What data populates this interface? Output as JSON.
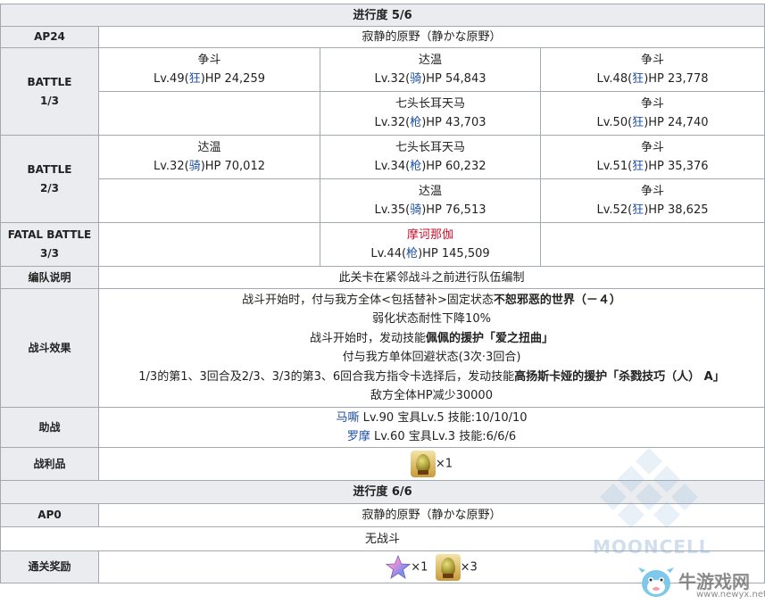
{
  "progress5": {
    "header": "进行度 5/6",
    "ap_label": "AP24",
    "location": "寂静的原野（静かな原野）",
    "battles": [
      {
        "label": [
          "BATTLE",
          "1/3"
        ],
        "rows": [
          [
            {
              "name": "争斗",
              "lv": "Lv.49(",
              "cls": "狂",
              "hp": ")HP 24,259"
            },
            {
              "name": "达温",
              "lv": "Lv.32(",
              "cls": "骑",
              "hp": ")HP 54,843"
            },
            {
              "name": "争斗",
              "lv": "Lv.48(",
              "cls": "狂",
              "hp": ")HP 23,778"
            }
          ],
          [
            null,
            {
              "name": "七头长耳天马",
              "lv": "Lv.32(",
              "cls": "枪",
              "hp": ")HP 43,703"
            },
            {
              "name": "争斗",
              "lv": "Lv.50(",
              "cls": "狂",
              "hp": ")HP 24,740"
            }
          ]
        ]
      },
      {
        "label": [
          "BATTLE",
          "2/3"
        ],
        "rows": [
          [
            {
              "name": "达温",
              "lv": "Lv.32(",
              "cls": "骑",
              "hp": ")HP 70,012"
            },
            {
              "name": "七头长耳天马",
              "lv": "Lv.34(",
              "cls": "枪",
              "hp": ")HP 60,232"
            },
            {
              "name": "争斗",
              "lv": "Lv.51(",
              "cls": "狂",
              "hp": ")HP 35,376"
            }
          ],
          [
            null,
            {
              "name": "达温",
              "lv": "Lv.35(",
              "cls": "骑",
              "hp": ")HP 76,513"
            },
            {
              "name": "争斗",
              "lv": "Lv.52(",
              "cls": "狂",
              "hp": ")HP 38,625"
            }
          ]
        ]
      },
      {
        "label": [
          "FATAL BATTLE",
          "3/3"
        ],
        "rows": [
          [
            null,
            {
              "name": "摩诃那伽",
              "lv": "Lv.44(",
              "cls": "枪",
              "hp": ")HP 145,509",
              "boss": true
            },
            null
          ]
        ]
      }
    ],
    "formation_label": "编队说明",
    "formation_text": "此关卡在紧邻战斗之前进行队伍编制",
    "effects_label": "战斗效果",
    "effects": [
      {
        "pre": "战斗开始时，付与我方全体<包括替补>固定状态",
        "bold": "不恕邪恶的世界（－４）",
        "post": ""
      },
      {
        "pre": "弱化状态耐性下降10%",
        "bold": "",
        "post": ""
      },
      {
        "pre": "战斗开始时，发动技能",
        "bold": "佩佩的援护「爱之扭曲」",
        "post": ""
      },
      {
        "pre": "付与我方单体回避状态(3次·3回合)",
        "bold": "",
        "post": ""
      },
      {
        "pre": "1/3的第1、3回合及2/3、3/3的第3、6回合我方指令卡选择后，发动技能",
        "bold": "高扬斯卡娅的援护「杀戮技巧（人） A」",
        "post": ""
      },
      {
        "pre": "敌方全体HP减少30000",
        "bold": "",
        "post": ""
      }
    ],
    "support_label": "助战",
    "supports": [
      {
        "name": "马嘶",
        "info": " Lv.90 宝具Lv.5 技能:10/10/10"
      },
      {
        "name": "罗摩",
        "info": " Lv.60 宝具Lv.3 技能:6/6/6"
      }
    ],
    "loot_label": "战利品",
    "loot": {
      "icon": "golden-egg-item-icon",
      "count": "×1"
    }
  },
  "progress6": {
    "header": "进行度 6/6",
    "ap_label": "AP0",
    "location": "寂静的原野（静かな原野）",
    "no_battle": "无战斗",
    "reward_label": "通关奖励",
    "rewards": [
      {
        "icon": "saint-quartz-icon",
        "count": "×1"
      },
      {
        "icon": "golden-egg-item-icon",
        "count": "×3"
      }
    ]
  },
  "watermarks": {
    "mooncell": "MOONCELL",
    "site_name": "牛游戏网",
    "site_url": "www.newyx.net"
  },
  "colors": {
    "header_bg": "#eaecf0",
    "border": "#a2a9b1",
    "class_blue": "#1d4fa8",
    "boss_red": "#c8102e"
  }
}
